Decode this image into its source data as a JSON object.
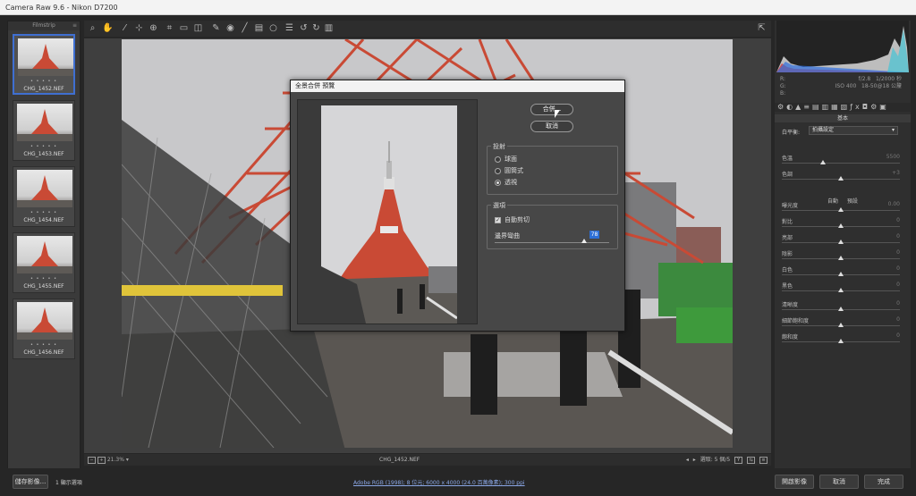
{
  "window": {
    "title": "Camera Raw 9.6  -  Nikon D7200"
  },
  "filmstrip": {
    "header": "Filmstrip",
    "items": [
      {
        "name": "CHG_1452.NEF",
        "stars": "• • • • •",
        "selected": true
      },
      {
        "name": "CHG_1453.NEF",
        "stars": "• • • • •",
        "selected": false
      },
      {
        "name": "CHG_1454.NEF",
        "stars": "• • • • •",
        "selected": false
      },
      {
        "name": "CHG_1455.NEF",
        "stars": "• • • • •",
        "selected": false
      },
      {
        "name": "CHG_1456.NEF",
        "stars": "• • • • •",
        "selected": false
      }
    ]
  },
  "toolbar": {
    "icons": [
      "zoom-icon",
      "hand-icon",
      "white-balance-icon",
      "color-sampler-icon",
      "target-adjust-icon",
      "crop-icon",
      "straighten-icon",
      "transform-icon",
      "spot-removal-icon",
      "red-eye-icon",
      "adjustment-brush-icon",
      "graduated-filter-icon",
      "radial-filter-icon",
      "preferences-icon",
      "rotate-left-icon",
      "rotate-right-icon",
      "trash-icon"
    ]
  },
  "status": {
    "zoom": "21.3%",
    "filename": "CHG_1452.NEF",
    "selection": "選取: 5 個/5"
  },
  "bottombar": {
    "save_label": "儲存影像...",
    "display_label": "1 顯示選項",
    "workflow_link": "Adobe RGB (1998); 8 位元; 6000 x 4000 (24.0 百萬像素); 300 ppi",
    "open_label": "開啟影像",
    "cancel_label": "取消",
    "done_label": "完成"
  },
  "right_panel": {
    "camera_info": {
      "left": "R:\nG:\nB:",
      "right": "f/2.8   1/2000 秒\nISO 400   18-50@18 公釐"
    },
    "section_title": "基本",
    "wb_label": "白平衡:",
    "wb_value": "拍攝設定",
    "auto_default": "自動 預設",
    "sliders": [
      {
        "label": "色溫",
        "value": "5500",
        "pos": 0.35
      },
      {
        "label": "色調",
        "value": "+3",
        "pos": 0.5
      },
      {
        "label": "曝光度",
        "value": "0.00",
        "pos": 0.5
      },
      {
        "label": "對比",
        "value": "0",
        "pos": 0.5
      },
      {
        "label": "亮部",
        "value": "0",
        "pos": 0.5
      },
      {
        "label": "陰影",
        "value": "0",
        "pos": 0.5
      },
      {
        "label": "白色",
        "value": "0",
        "pos": 0.5
      },
      {
        "label": "黑色",
        "value": "0",
        "pos": 0.5
      },
      {
        "label": "清晰度",
        "value": "0",
        "pos": 0.5
      },
      {
        "label": "細節飽和度",
        "value": "0",
        "pos": 0.5
      },
      {
        "label": "飽和度",
        "value": "0",
        "pos": 0.5
      }
    ]
  },
  "dialog": {
    "title": "全景合併 預覽",
    "merge_label": "合併...",
    "cancel_label": "取消",
    "projection_title": "投射",
    "projections": [
      {
        "label": "球面",
        "checked": false
      },
      {
        "label": "圓筒式",
        "checked": false
      },
      {
        "label": "透視",
        "checked": true
      }
    ],
    "options_title": "選項",
    "auto_crop_label": "自動剪切",
    "boundary_label": "邊界彎曲",
    "boundary_value": "78",
    "boundary_fraction": 0.78
  }
}
